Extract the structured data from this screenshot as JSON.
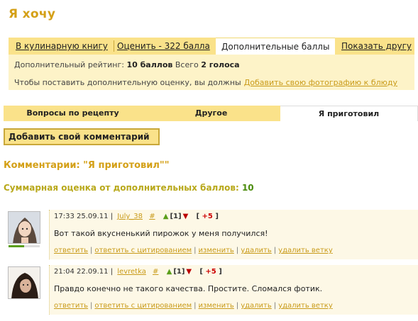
{
  "page": {
    "title": "Я хочу"
  },
  "tabs": [
    {
      "label": "В кулинарную книгу",
      "active": false
    },
    {
      "label": "Оценить - 322 балла",
      "active": false
    },
    {
      "label": "Дополнительные баллы",
      "active": true
    },
    {
      "label": "Показать другу",
      "active": false
    }
  ],
  "rating": {
    "prefix": "Дополнительный рейтинг:",
    "points": "10 баллов",
    "total_label": "Всего",
    "votes": "2 голоса",
    "notice": "Чтобы поставить дополнительную оценку, вы должны",
    "notice_link": "Добавить свою фотографию к блюду"
  },
  "tabs2": [
    {
      "label": "Вопросы по рецепту",
      "active": false
    },
    {
      "label": "Другое",
      "active": false
    },
    {
      "label": "Я приготовил",
      "active": true
    }
  ],
  "add_comment_label": "Добавить свой комментарий",
  "comments_title": "Комментарии: \"Я приготовил\"\"",
  "summary": {
    "label": "Суммарная оценка от дополнительных баллов:",
    "value": "10"
  },
  "comments": [
    {
      "time": "17:33 25.09.11",
      "sep": "|",
      "user": "July_38",
      "hash": "#",
      "up_arrow": "▲",
      "count": "[1]",
      "down_arrow": "▼",
      "score_open": "[",
      "score": "+5",
      "score_close": "]",
      "text": "Вот такой вкусненький пирожок у меня получился!",
      "actions": [
        "ответить",
        "ответить с цитированием",
        "изменить",
        "удалить",
        "удалить ветку"
      ]
    },
    {
      "time": "21:04 22.09.11",
      "sep": "|",
      "user": "levretka",
      "hash": "#",
      "up_arrow": "▲",
      "count": "[1]",
      "down_arrow": "▼",
      "score_open": "[",
      "score": "+5",
      "score_close": "]",
      "text": "Правдо конечно не такого качества. Простите. Сломался фотик.",
      "actions": [
        "ответить",
        "ответить с цитированием",
        "изменить",
        "удалить",
        "удалить ветку"
      ]
    }
  ]
}
